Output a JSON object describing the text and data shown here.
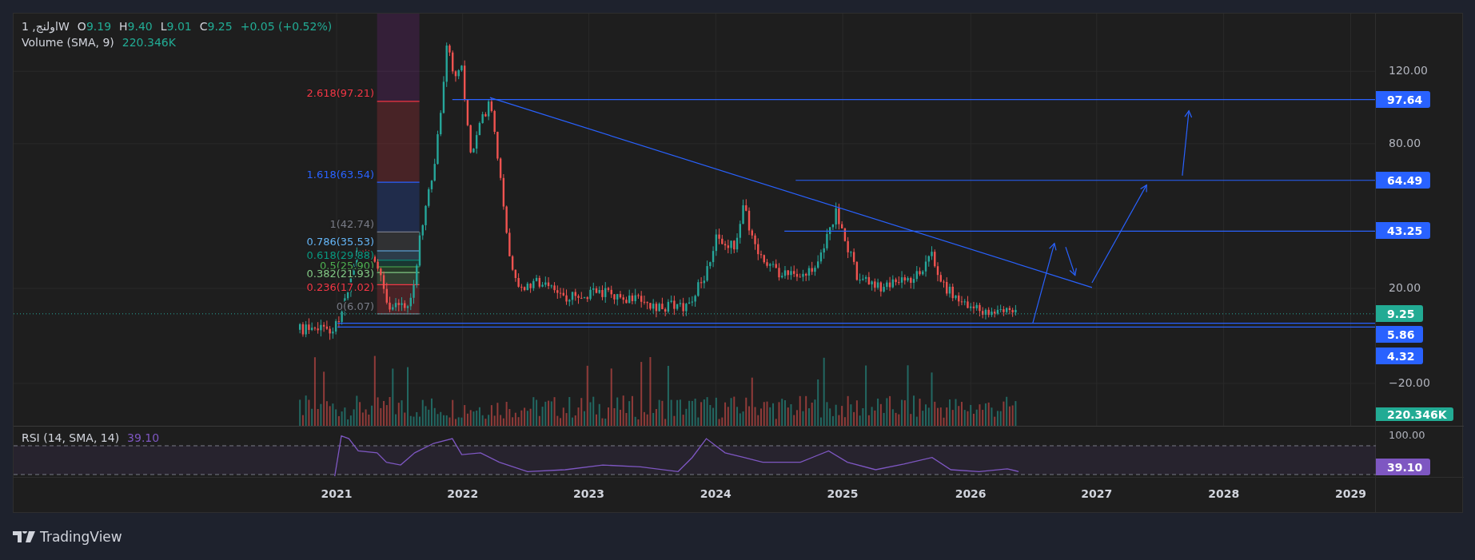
{
  "legend": {
    "symbol": "1 ,اولنجW",
    "ohlc": [
      {
        "label": "O",
        "value": "9.19"
      },
      {
        "label": "H",
        "value": "9.40"
      },
      {
        "label": "L",
        "value": "9.01"
      },
      {
        "label": "C",
        "value": "9.25"
      }
    ],
    "change": "+0.05 (+0.52%)",
    "volume_label": "Volume (SMA, 9)",
    "volume_value": "220.346K"
  },
  "fib_levels": [
    {
      "label": "2.618(97.21)",
      "color": "#f23645"
    },
    {
      "label": "1.618(63.54)",
      "color": "#2962ff"
    },
    {
      "label": "1(42.74)",
      "color": "#787b86"
    },
    {
      "label": "0.786(35.53)",
      "color": "#64b5f6"
    },
    {
      "label": "0.618(29.88)",
      "color": "#089981"
    },
    {
      "label": "0.5(25.90)",
      "color": "#4caf50"
    },
    {
      "label": "0.382(21.93)",
      "color": "#81c784"
    },
    {
      "label": "0.236(17.02)",
      "color": "#f23645"
    },
    {
      "label": "0(6.07)",
      "color": "#787b86"
    }
  ],
  "price_axis": {
    "ticks": [
      "120.00",
      "80.00",
      "20.00",
      "−20.00"
    ]
  },
  "price_badges": [
    {
      "value": "97.64",
      "kind": "line"
    },
    {
      "value": "64.49",
      "kind": "line"
    },
    {
      "value": "43.25",
      "kind": "line"
    },
    {
      "value": "9.25",
      "kind": "last"
    },
    {
      "value": "5.86",
      "kind": "line"
    },
    {
      "value": "4.32",
      "kind": "line"
    }
  ],
  "volume_badge": "220.346K",
  "rsi": {
    "label": "RSI (14, SMA, 14)",
    "value": "39.10",
    "axis_tick": "100.00",
    "badge": "39.10"
  },
  "time_axis": [
    "2021",
    "2022",
    "2023",
    "2024",
    "2025",
    "2026",
    "2027",
    "2028",
    "2029"
  ],
  "brand": "TradingView"
}
